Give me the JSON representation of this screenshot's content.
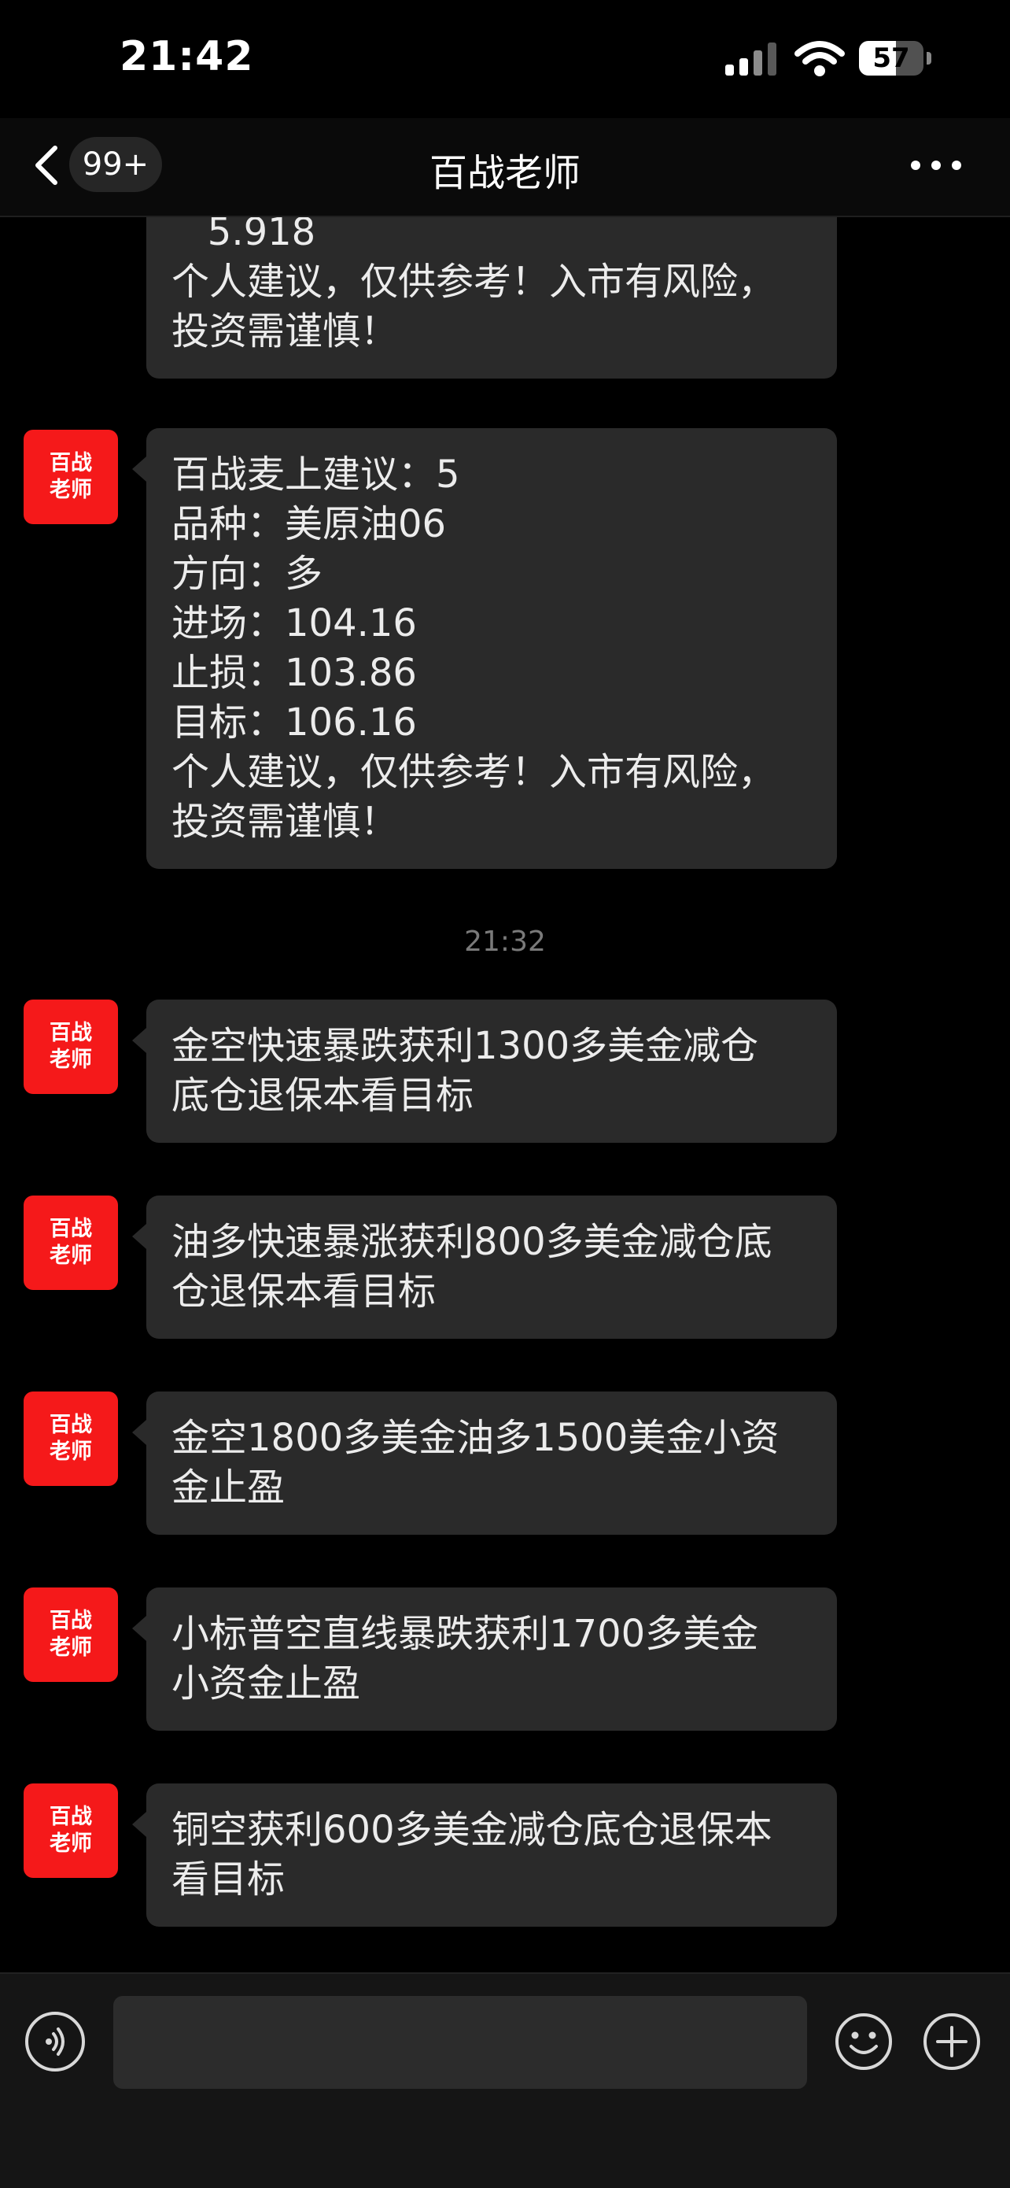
{
  "status_bar": {
    "time": "21:42",
    "battery": "57"
  },
  "nav": {
    "unread_badge": "99+",
    "title": "百战老师"
  },
  "avatar_text": [
    "百战",
    "老师"
  ],
  "messages": [
    {
      "id": "m0",
      "lines": [
        "   5.918",
        "个人建议，仅供参考！入市有风险，",
        "投资需谨慎！"
      ],
      "avatar": false
    },
    {
      "id": "m1",
      "lines": [
        "百战麦上建议：5",
        "品种：美原油06",
        "方向：多",
        "进场：104.16",
        "止损：103.86",
        "目标：106.16",
        "个人建议，仅供参考！入市有风险，",
        "投资需谨慎！"
      ],
      "avatar": true
    },
    {
      "id": "m2",
      "lines": [
        "金空快速暴跌获利1300多美金减仓",
        "底仓退保本看目标"
      ],
      "avatar": true
    },
    {
      "id": "m3",
      "lines": [
        "油多快速暴涨获利800多美金减仓底",
        "仓退保本看目标"
      ],
      "avatar": true
    },
    {
      "id": "m4",
      "lines": [
        "金空1800多美金油多1500美金小资",
        "金止盈"
      ],
      "avatar": true
    },
    {
      "id": "m5",
      "lines": [
        "小标普空直线暴跌获利1700多美金",
        "小资金止盈"
      ],
      "avatar": true
    },
    {
      "id": "m6",
      "lines": [
        "铜空获利600多美金减仓底仓退保本",
        "看目标"
      ],
      "avatar": true
    }
  ],
  "timestamp": "21:32",
  "input": {
    "value": ""
  },
  "colors": {
    "avatar_bg": "#f5191a",
    "bubble_bg": "#2a2a2a",
    "background": "#000000"
  }
}
